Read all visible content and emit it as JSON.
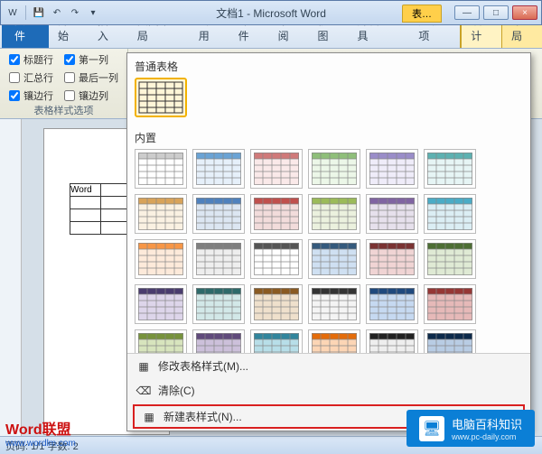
{
  "titlebar": {
    "doc_title": "文档1 - Microsoft Word",
    "context_title": "表…",
    "min": "—",
    "max": "□",
    "close": "×"
  },
  "tabs": {
    "file": "文件",
    "list": [
      "开始",
      "插入",
      "页面布局",
      "引用",
      "邮件",
      "审阅",
      "视图",
      "开发工具",
      "加载项"
    ],
    "context": {
      "design": "设计",
      "layout": "布局"
    }
  },
  "ribbon": {
    "options_group_label": "表格样式选项",
    "checks": {
      "header_row": {
        "label": "标题行",
        "checked": true
      },
      "first_col": {
        "label": "第一列",
        "checked": true
      },
      "total_row": {
        "label": "汇总行",
        "checked": false
      },
      "last_col": {
        "label": "最后一列",
        "checked": false
      },
      "banded_row": {
        "label": "镶边行",
        "checked": true
      },
      "banded_col": {
        "label": "镶边列",
        "checked": false
      }
    }
  },
  "gallery": {
    "section_plain": "普通表格",
    "section_builtin": "内置",
    "footer": {
      "modify": "修改表格样式(M)...",
      "clear": "清除(C)",
      "new": "新建表样式(N)..."
    }
  },
  "document": {
    "sample_cell": "Word"
  },
  "status": {
    "text": "页码: 1/1  字数: 2"
  },
  "watermark": {
    "left_title": "Word联盟",
    "left_url": "www.wordlm.com",
    "right_title": "电脑百科知识",
    "right_url": "www.pc-daily.com"
  },
  "icons": {
    "word": "W",
    "save": "💾",
    "undo": "↶",
    "redo": "↷",
    "dropdown": "▾",
    "table": "▦",
    "clear": "⌫",
    "monitor": "🖥"
  }
}
